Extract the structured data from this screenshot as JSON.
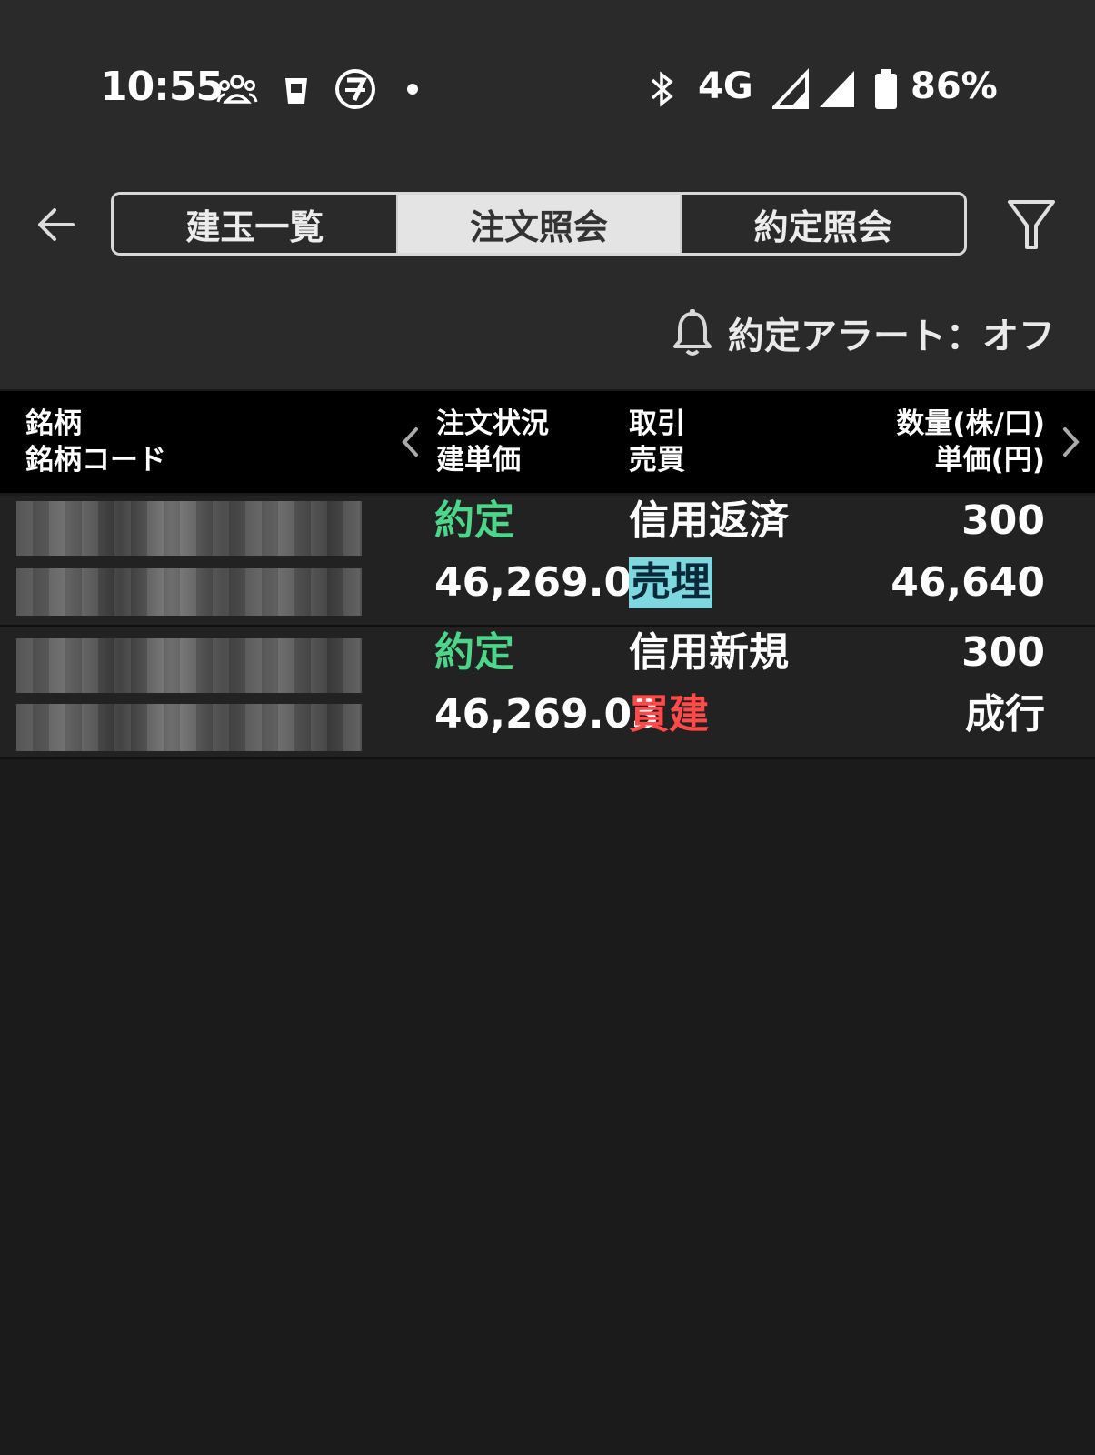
{
  "status_bar": {
    "time": "10:55",
    "network": "4G",
    "battery": "86%",
    "icons": [
      "people-icon",
      "cup-icon",
      "seven-eleven-icon",
      "dot-icon",
      "bluetooth-icon",
      "signal-icon",
      "signal-icon",
      "battery-icon"
    ]
  },
  "tabs": [
    {
      "label": "建玉一覧",
      "active": false
    },
    {
      "label": "注文照会",
      "active": true
    },
    {
      "label": "約定照会",
      "active": false
    }
  ],
  "alert": {
    "label": "約定アラート：オフ"
  },
  "table": {
    "headers": {
      "col1": [
        "銘柄",
        "銘柄コード"
      ],
      "col2": [
        "注文状況",
        "建単価"
      ],
      "col3": [
        "取引",
        "売買"
      ],
      "col4": [
        "数量(株/口)",
        "単価(円)"
      ]
    },
    "rows": [
      {
        "status": "約定",
        "price": "46,269.03",
        "trade": "信用返済",
        "side": "売埋",
        "side_color": "#7ed8e0",
        "qty": "300",
        "unit_price": "46,640"
      },
      {
        "status": "約定",
        "price": "46,269.03",
        "trade": "信用新規",
        "side": "買建",
        "side_color": "#ff4a4a",
        "qty": "300",
        "unit_price": "成行"
      }
    ]
  },
  "colors": {
    "status_green": "#4cd68a",
    "buy_red": "#ff4a4a",
    "sell_cyan": "#7ed8e0"
  }
}
